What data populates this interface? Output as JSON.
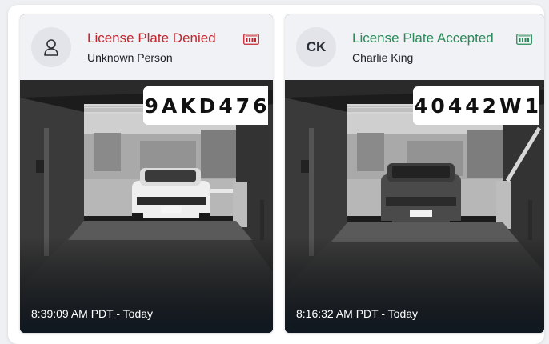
{
  "events": [
    {
      "status": "denied",
      "title": "License Plate Denied",
      "person": "Unknown Person",
      "avatar_initials": "",
      "avatar_icon": "user-icon",
      "plate": "9AKD476",
      "timestamp": "8:39:09 AM PDT - Today",
      "title_color": "#c3252f"
    },
    {
      "status": "accepted",
      "title": "License Plate Accepted",
      "person": "Charlie King",
      "avatar_initials": "CK",
      "plate": "40442W1",
      "timestamp": "8:16:32 AM PDT - Today",
      "title_color": "#2a8a5a"
    }
  ],
  "icons": {
    "status_icon": "license-plate-icon"
  }
}
